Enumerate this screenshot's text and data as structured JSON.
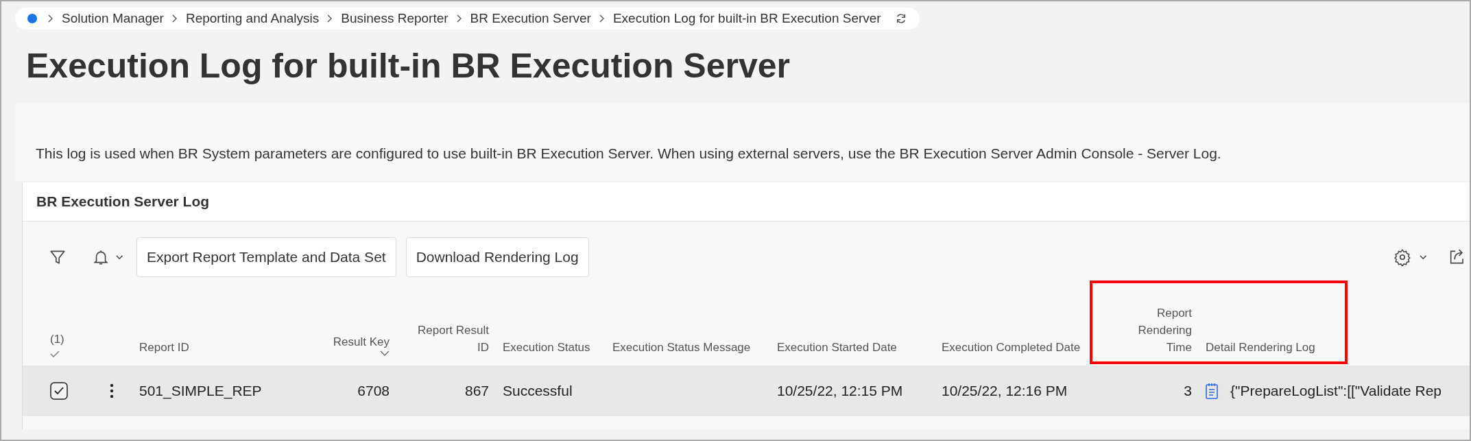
{
  "breadcrumb": {
    "items": [
      "Solution Manager",
      "Reporting and Analysis",
      "Business Reporter",
      "BR Execution Server",
      "Execution Log for built-in BR Execution Server"
    ]
  },
  "title": "Execution Log for built-in BR Execution Server",
  "info": "This log is used when BR System parameters are configured to use built-in BR Execution Server. When using external servers, use the BR Execution Server Admin Console - Server Log.",
  "panel": {
    "title": "BR Execution Server Log",
    "toolbar_buttons": [
      "Export Report Template and Data Set",
      "Download Rendering Log"
    ],
    "selection_count": "(1)",
    "columns": [
      {
        "label": "Report ID",
        "kind": "text",
        "sorted": false,
        "highlighted": false
      },
      {
        "label": "Result Key",
        "kind": "number",
        "sorted": true,
        "highlighted": false
      },
      {
        "label": "Report Result ID",
        "kind": "number",
        "sorted": false,
        "highlighted": false
      },
      {
        "label": "Execution Status",
        "kind": "text",
        "sorted": false,
        "highlighted": false
      },
      {
        "label": "Execution Status Message",
        "kind": "text",
        "sorted": false,
        "highlighted": false
      },
      {
        "label": "Execution Started Date",
        "kind": "text",
        "sorted": false,
        "highlighted": false
      },
      {
        "label": "Execution Completed Date",
        "kind": "text",
        "sorted": false,
        "highlighted": false
      },
      {
        "label": "Report Rendering Time",
        "kind": "number",
        "sorted": false,
        "highlighted": true
      },
      {
        "label": "Detail Rendering Log",
        "kind": "log",
        "sorted": false,
        "highlighted": true
      }
    ],
    "rows": [
      {
        "selected": true,
        "cells": [
          "501_SIMPLE_REP",
          "6708",
          "867",
          "Successful",
          "",
          "10/25/22, 12:15 PM",
          "10/25/22, 12:16 PM",
          "3",
          "{\"PrepareLogList\":[[\"Validate Rep"
        ]
      }
    ]
  }
}
